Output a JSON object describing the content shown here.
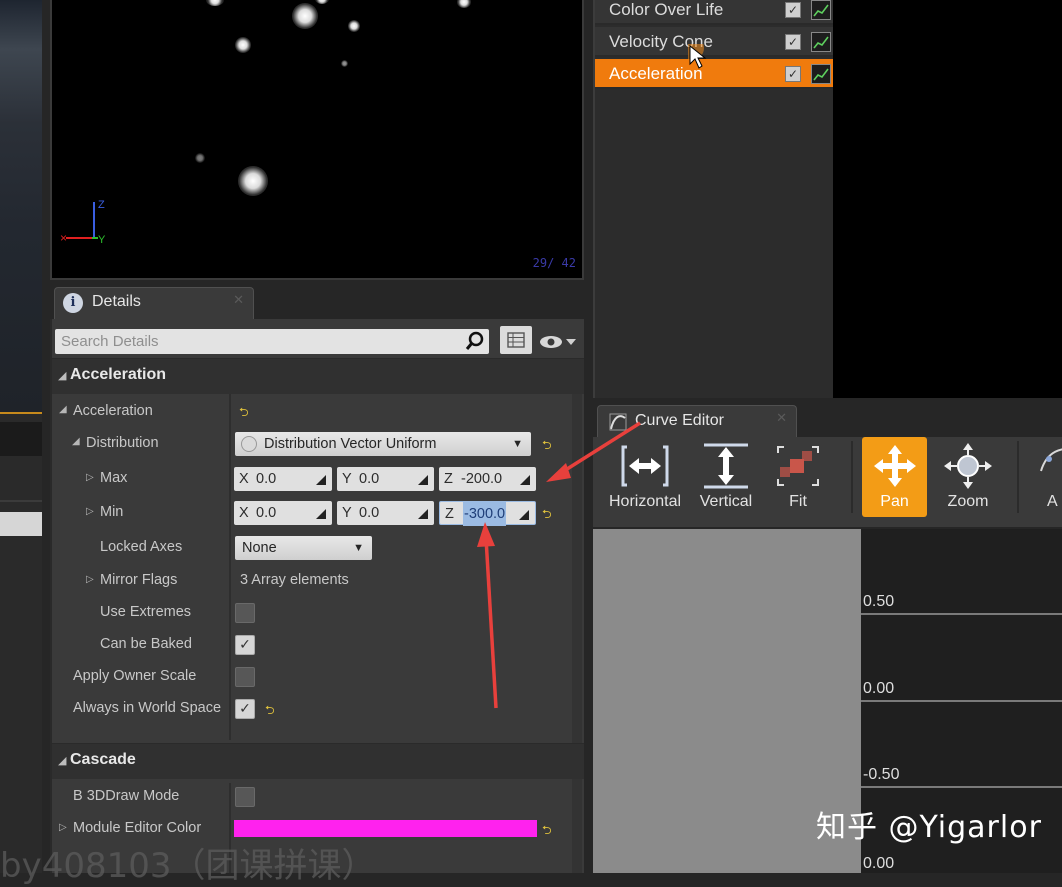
{
  "viewport": {
    "frame_counter": "29/  42",
    "axis_y": "Y",
    "axis_z": "Z"
  },
  "modules": {
    "items": [
      {
        "label": "Color Over Life",
        "selected": false
      },
      {
        "label": "Velocity Cone",
        "selected": false
      },
      {
        "label": "Acceleration",
        "selected": true
      }
    ]
  },
  "details": {
    "tab_label": "Details",
    "search_placeholder": "Search Details",
    "category_acceleration": "Acceleration",
    "acceleration_label": "Acceleration",
    "distribution_label": "Distribution",
    "distribution_value": "Distribution Vector Uniform",
    "max_label": "Max",
    "max": {
      "x": "0.0",
      "y": "0.0",
      "z": "-200.0"
    },
    "min_label": "Min",
    "min": {
      "x": "0.0",
      "y": "0.0",
      "z": "-300.0"
    },
    "locked_axes_label": "Locked Axes",
    "locked_axes_value": "None",
    "mirror_flags_label": "Mirror Flags",
    "mirror_flags_value": "3 Array elements",
    "use_extremes_label": "Use Extremes",
    "use_extremes": false,
    "can_be_baked_label": "Can be Baked",
    "can_be_baked": true,
    "apply_owner_scale_label": "Apply Owner Scale",
    "apply_owner_scale": false,
    "always_world_space_label": "Always in World Space",
    "always_world_space": true,
    "category_cascade": "Cascade",
    "b3d_draw_mode_label": "B 3DDraw Mode",
    "b3d_draw_mode": false,
    "module_editor_color_label": "Module Editor Color",
    "module_editor_color": "#ff22ee"
  },
  "curve_editor": {
    "tab_label": "Curve Editor",
    "tools": {
      "horizontal": "Horizontal",
      "vertical": "Vertical",
      "fit": "Fit",
      "pan": "Pan",
      "zoom": "Zoom",
      "partial": "A"
    },
    "grid_labels": [
      "0.50",
      "0.00",
      "-0.50",
      "0.00"
    ]
  },
  "overlay": {
    "watermark": "知乎 @Yigarlor",
    "bottom_text": "by408103（团课拼课）"
  },
  "colors": {
    "accent": "#f07b0d",
    "pan_active": "#f39c16",
    "arrow": "#e8403c"
  }
}
